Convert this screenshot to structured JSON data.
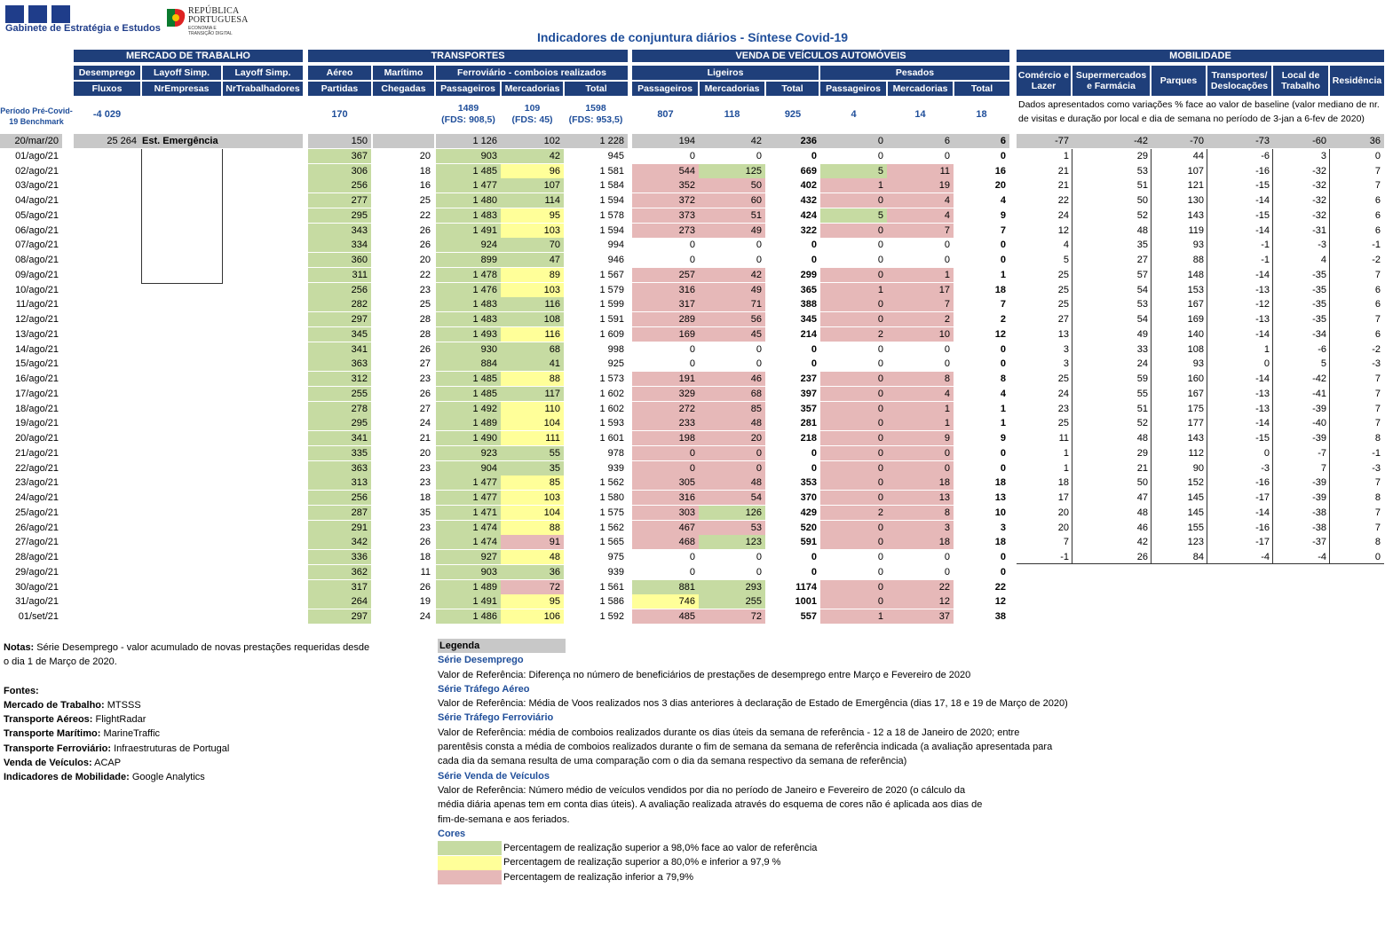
{
  "org_name": "Gabinete de Estratégia e Estudos",
  "rep_logo": {
    "line1": "REPÚBLICA",
    "line2": "PORTUGUESA",
    "line3": "ECONOMIA E TRANSIÇÃO DIGITAL"
  },
  "title": "Indicadores de conjuntura diários - Síntese Covid-19",
  "sections": {
    "mercado": "MERCADO DE TRABALHO",
    "transportes": "TRANSPORTES",
    "veiculos": "VENDA DE VEÍCULOS AUTOMÓVEIS",
    "mobilidade": "MOBILIDADE"
  },
  "headers": {
    "desemprego": "Desemprego",
    "fluxos": "Fluxos",
    "layoff1": "Layoff Simp.",
    "nrempresas": "NrEmpresas",
    "layoff2": "Layoff Simp.",
    "nrtrab": "NrTrabalhadores",
    "aereo": "Aéreo",
    "partidas": "Partidas",
    "maritimo": "Marítimo",
    "chegadas": "Chegadas",
    "ferroviario": "Ferroviário - comboios realizados",
    "passageiros": "Passageiros",
    "mercadorias": "Mercadorias",
    "total": "Total",
    "ligeiros": "Ligeiros",
    "pesados": "Pesados",
    "comercio": "Comércio e Lazer",
    "supermercados": "Supermercados e Farmácia",
    "parques": "Parques",
    "transportes_desl": "Transportes/ Deslocações",
    "local_trabalho": "Local de Trabalho",
    "residencia": "Residência"
  },
  "benchmark": {
    "label": "Período Pré-Covid-19 Benchmark",
    "desemprego": "-4 029",
    "aereo": "170",
    "ferro_pass": "1489",
    "ferro_pass_fds": "(FDS: 908,5)",
    "ferro_merc": "109",
    "ferro_merc_fds": "(FDS: 45)",
    "ferro_total": "1598",
    "ferro_total_fds": "(FDS: 953,5)",
    "lig_pass": "807",
    "lig_merc": "118",
    "lig_total": "925",
    "pes_pass": "4",
    "pes_merc": "14",
    "pes_total": "18",
    "mobility_note": "Dados apresentados como variações % face ao valor de baseline (valor mediano de nr. de visitas e duração por local e dia de semana no período de 3-jan a 6-fev de 2020)"
  },
  "ref_row": {
    "date": "20/mar/20",
    "desemprego": "25 264",
    "label": "Est. Emergência",
    "aereo": "150",
    "ferro_pass": "1 126",
    "ferro_merc": "102",
    "ferro_total": "1 228",
    "lig_pass": "194",
    "lig_merc": "42",
    "lig_total": "236",
    "pes_pass": "0",
    "pes_merc": "6",
    "pes_total": "6",
    "mob": [
      "-77",
      "-42",
      "-70",
      "-73",
      "-60",
      "36"
    ]
  },
  "colors": {
    "green": "#c6dba2",
    "yellow": "#ffff99",
    "red": "#e6b8b8",
    "header": "#1f3f7a",
    "title": "#1f4e9a"
  },
  "rows": [
    {
      "date": "01/ago/21",
      "aer": "367",
      "mar": "20",
      "fp": "903",
      "fm": "42",
      "ft": "945",
      "lp": "0",
      "lm": "0",
      "lt": "0",
      "pp": "0",
      "pm": "0",
      "pt": "0",
      "mob": [
        "1",
        "29",
        "44",
        "-6",
        "3",
        "0"
      ],
      "c": {
        "fm": "g"
      }
    },
    {
      "date": "02/ago/21",
      "aer": "306",
      "mar": "18",
      "fp": "1 485",
      "fm": "96",
      "ft": "1 581",
      "lp": "544",
      "lm": "125",
      "lt": "669",
      "pp": "5",
      "pm": "11",
      "pt": "16",
      "mob": [
        "21",
        "53",
        "107",
        "-16",
        "-32",
        "7"
      ],
      "c": {
        "fm": "y",
        "lp": "r",
        "lm": "g",
        "pp": "g",
        "pm": "r"
      }
    },
    {
      "date": "03/ago/21",
      "aer": "256",
      "mar": "16",
      "fp": "1 477",
      "fm": "107",
      "ft": "1 584",
      "lp": "352",
      "lm": "50",
      "lt": "402",
      "pp": "1",
      "pm": "19",
      "pt": "20",
      "mob": [
        "21",
        "51",
        "121",
        "-15",
        "-32",
        "7"
      ],
      "c": {
        "fm": "g",
        "lp": "r",
        "lm": "r",
        "pp": "r",
        "pm": "r"
      }
    },
    {
      "date": "04/ago/21",
      "aer": "277",
      "mar": "25",
      "fp": "1 480",
      "fm": "114",
      "ft": "1 594",
      "lp": "372",
      "lm": "60",
      "lt": "432",
      "pp": "0",
      "pm": "4",
      "pt": "4",
      "mob": [
        "22",
        "50",
        "130",
        "-14",
        "-32",
        "6"
      ],
      "c": {
        "fm": "g",
        "lp": "r",
        "lm": "r",
        "pp": "r",
        "pm": "r"
      }
    },
    {
      "date": "05/ago/21",
      "aer": "295",
      "mar": "22",
      "fp": "1 483",
      "fm": "95",
      "ft": "1 578",
      "lp": "373",
      "lm": "51",
      "lt": "424",
      "pp": "5",
      "pm": "4",
      "pt": "9",
      "mob": [
        "24",
        "52",
        "143",
        "-15",
        "-32",
        "6"
      ],
      "c": {
        "fm": "y",
        "lp": "r",
        "lm": "r",
        "pp": "g",
        "pm": "r"
      }
    },
    {
      "date": "06/ago/21",
      "aer": "343",
      "mar": "26",
      "fp": "1 491",
      "fm": "103",
      "ft": "1 594",
      "lp": "273",
      "lm": "49",
      "lt": "322",
      "pp": "0",
      "pm": "7",
      "pt": "7",
      "mob": [
        "12",
        "48",
        "119",
        "-14",
        "-31",
        "6"
      ],
      "c": {
        "fm": "y",
        "lp": "r",
        "lm": "r",
        "pp": "r",
        "pm": "r"
      }
    },
    {
      "date": "07/ago/21",
      "aer": "334",
      "mar": "26",
      "fp": "924",
      "fm": "70",
      "ft": "994",
      "lp": "0",
      "lm": "0",
      "lt": "0",
      "pp": "0",
      "pm": "0",
      "pt": "0",
      "mob": [
        "4",
        "35",
        "93",
        "-1",
        "-3",
        "-1"
      ],
      "c": {
        "fm": "g"
      }
    },
    {
      "date": "08/ago/21",
      "aer": "360",
      "mar": "20",
      "fp": "899",
      "fm": "47",
      "ft": "946",
      "lp": "0",
      "lm": "0",
      "lt": "0",
      "pp": "0",
      "pm": "0",
      "pt": "0",
      "mob": [
        "5",
        "27",
        "88",
        "-1",
        "4",
        "-2"
      ],
      "c": {
        "fm": "g"
      }
    },
    {
      "date": "09/ago/21",
      "aer": "311",
      "mar": "22",
      "fp": "1 478",
      "fm": "89",
      "ft": "1 567",
      "lp": "257",
      "lm": "42",
      "lt": "299",
      "pp": "0",
      "pm": "1",
      "pt": "1",
      "mob": [
        "25",
        "57",
        "148",
        "-14",
        "-35",
        "7"
      ],
      "c": {
        "fm": "y",
        "lp": "r",
        "lm": "r",
        "pp": "r",
        "pm": "r"
      }
    },
    {
      "date": "10/ago/21",
      "aer": "256",
      "mar": "23",
      "fp": "1 476",
      "fm": "103",
      "ft": "1 579",
      "lp": "316",
      "lm": "49",
      "lt": "365",
      "pp": "1",
      "pm": "17",
      "pt": "18",
      "mob": [
        "25",
        "54",
        "153",
        "-13",
        "-35",
        "6"
      ],
      "c": {
        "fm": "y",
        "lp": "r",
        "lm": "r",
        "pp": "r",
        "pm": "r"
      }
    },
    {
      "date": "11/ago/21",
      "aer": "282",
      "mar": "25",
      "fp": "1 483",
      "fm": "116",
      "ft": "1 599",
      "lp": "317",
      "lm": "71",
      "lt": "388",
      "pp": "0",
      "pm": "7",
      "pt": "7",
      "mob": [
        "25",
        "53",
        "167",
        "-12",
        "-35",
        "6"
      ],
      "c": {
        "fm": "g",
        "lp": "r",
        "lm": "r",
        "pp": "r",
        "pm": "r"
      }
    },
    {
      "date": "12/ago/21",
      "aer": "297",
      "mar": "28",
      "fp": "1 483",
      "fm": "108",
      "ft": "1 591",
      "lp": "289",
      "lm": "56",
      "lt": "345",
      "pp": "0",
      "pm": "2",
      "pt": "2",
      "mob": [
        "27",
        "54",
        "169",
        "-13",
        "-35",
        "7"
      ],
      "c": {
        "fm": "g",
        "lp": "r",
        "lm": "r",
        "pp": "r",
        "pm": "r"
      }
    },
    {
      "date": "13/ago/21",
      "aer": "345",
      "mar": "28",
      "fp": "1 493",
      "fm": "116",
      "ft": "1 609",
      "lp": "169",
      "lm": "45",
      "lt": "214",
      "pp": "2",
      "pm": "10",
      "pt": "12",
      "mob": [
        "13",
        "49",
        "140",
        "-14",
        "-34",
        "6"
      ],
      "c": {
        "fm": "y",
        "lp": "r",
        "lm": "r",
        "pp": "r",
        "pm": "r"
      }
    },
    {
      "date": "14/ago/21",
      "aer": "341",
      "mar": "26",
      "fp": "930",
      "fm": "68",
      "ft": "998",
      "lp": "0",
      "lm": "0",
      "lt": "0",
      "pp": "0",
      "pm": "0",
      "pt": "0",
      "mob": [
        "3",
        "33",
        "108",
        "1",
        "-6",
        "-2"
      ],
      "c": {
        "fm": "g"
      }
    },
    {
      "date": "15/ago/21",
      "aer": "363",
      "mar": "27",
      "fp": "884",
      "fm": "41",
      "ft": "925",
      "lp": "0",
      "lm": "0",
      "lt": "0",
      "pp": "0",
      "pm": "0",
      "pt": "0",
      "mob": [
        "3",
        "24",
        "93",
        "0",
        "5",
        "-3"
      ],
      "c": {
        "fm": "g"
      }
    },
    {
      "date": "16/ago/21",
      "aer": "312",
      "mar": "23",
      "fp": "1 485",
      "fm": "88",
      "ft": "1 573",
      "lp": "191",
      "lm": "46",
      "lt": "237",
      "pp": "0",
      "pm": "8",
      "pt": "8",
      "mob": [
        "25",
        "59",
        "160",
        "-14",
        "-42",
        "7"
      ],
      "c": {
        "fm": "y",
        "lp": "r",
        "lm": "r",
        "pp": "r",
        "pm": "r"
      }
    },
    {
      "date": "17/ago/21",
      "aer": "255",
      "mar": "26",
      "fp": "1 485",
      "fm": "117",
      "ft": "1 602",
      "lp": "329",
      "lm": "68",
      "lt": "397",
      "pp": "0",
      "pm": "4",
      "pt": "4",
      "mob": [
        "24",
        "55",
        "167",
        "-13",
        "-41",
        "7"
      ],
      "c": {
        "fm": "g",
        "lp": "r",
        "lm": "r",
        "pp": "r",
        "pm": "r"
      }
    },
    {
      "date": "18/ago/21",
      "aer": "278",
      "mar": "27",
      "fp": "1 492",
      "fm": "110",
      "ft": "1 602",
      "lp": "272",
      "lm": "85",
      "lt": "357",
      "pp": "0",
      "pm": "1",
      "pt": "1",
      "mob": [
        "23",
        "51",
        "175",
        "-13",
        "-39",
        "7"
      ],
      "c": {
        "fm": "y",
        "lp": "r",
        "lm": "r",
        "pp": "r",
        "pm": "r"
      }
    },
    {
      "date": "19/ago/21",
      "aer": "295",
      "mar": "24",
      "fp": "1 489",
      "fm": "104",
      "ft": "1 593",
      "lp": "233",
      "lm": "48",
      "lt": "281",
      "pp": "0",
      "pm": "1",
      "pt": "1",
      "mob": [
        "25",
        "52",
        "177",
        "-14",
        "-40",
        "7"
      ],
      "c": {
        "fm": "y",
        "lp": "r",
        "lm": "r",
        "pp": "r",
        "pm": "r"
      }
    },
    {
      "date": "20/ago/21",
      "aer": "341",
      "mar": "21",
      "fp": "1 490",
      "fm": "111",
      "ft": "1 601",
      "lp": "198",
      "lm": "20",
      "lt": "218",
      "pp": "0",
      "pm": "9",
      "pt": "9",
      "mob": [
        "11",
        "48",
        "143",
        "-15",
        "-39",
        "8"
      ],
      "c": {
        "fm": "y",
        "lp": "r",
        "lm": "r",
        "pp": "r",
        "pm": "r"
      }
    },
    {
      "date": "21/ago/21",
      "aer": "335",
      "mar": "20",
      "fp": "923",
      "fm": "55",
      "ft": "978",
      "lp": "0",
      "lm": "0",
      "lt": "0",
      "pp": "0",
      "pm": "0",
      "pt": "0",
      "mob": [
        "1",
        "29",
        "112",
        "0",
        "-7",
        "-1"
      ],
      "c": {
        "fm": "g",
        "lp": "r",
        "lm": "r",
        "pp": "r",
        "pm": "r"
      }
    },
    {
      "date": "22/ago/21",
      "aer": "363",
      "mar": "23",
      "fp": "904",
      "fm": "35",
      "ft": "939",
      "lp": "0",
      "lm": "0",
      "lt": "0",
      "pp": "0",
      "pm": "0",
      "pt": "0",
      "mob": [
        "1",
        "21",
        "90",
        "-3",
        "7",
        "-3"
      ],
      "c": {
        "fm": "g",
        "lp": "r",
        "lm": "r",
        "pp": "r",
        "pm": "r"
      }
    },
    {
      "date": "23/ago/21",
      "aer": "313",
      "mar": "23",
      "fp": "1 477",
      "fm": "85",
      "ft": "1 562",
      "lp": "305",
      "lm": "48",
      "lt": "353",
      "pp": "0",
      "pm": "18",
      "pt": "18",
      "mob": [
        "18",
        "50",
        "152",
        "-16",
        "-39",
        "7"
      ],
      "c": {
        "fm": "y",
        "lp": "r",
        "lm": "r",
        "pp": "r",
        "pm": "r"
      }
    },
    {
      "date": "24/ago/21",
      "aer": "256",
      "mar": "18",
      "fp": "1 477",
      "fm": "103",
      "ft": "1 580",
      "lp": "316",
      "lm": "54",
      "lt": "370",
      "pp": "0",
      "pm": "13",
      "pt": "13",
      "mob": [
        "17",
        "47",
        "145",
        "-17",
        "-39",
        "8"
      ],
      "c": {
        "fm": "y",
        "lp": "r",
        "lm": "r",
        "pp": "r",
        "pm": "r"
      }
    },
    {
      "date": "25/ago/21",
      "aer": "287",
      "mar": "35",
      "fp": "1 471",
      "fm": "104",
      "ft": "1 575",
      "lp": "303",
      "lm": "126",
      "lt": "429",
      "pp": "2",
      "pm": "8",
      "pt": "10",
      "mob": [
        "20",
        "48",
        "145",
        "-14",
        "-38",
        "7"
      ],
      "c": {
        "fm": "y",
        "lp": "r",
        "lm": "g",
        "pp": "r",
        "pm": "r"
      }
    },
    {
      "date": "26/ago/21",
      "aer": "291",
      "mar": "23",
      "fp": "1 474",
      "fm": "88",
      "ft": "1 562",
      "lp": "467",
      "lm": "53",
      "lt": "520",
      "pp": "0",
      "pm": "3",
      "pt": "3",
      "mob": [
        "20",
        "46",
        "155",
        "-16",
        "-38",
        "7"
      ],
      "c": {
        "fm": "y",
        "lp": "r",
        "lm": "r",
        "pp": "r",
        "pm": "r"
      }
    },
    {
      "date": "27/ago/21",
      "aer": "342",
      "mar": "26",
      "fp": "1 474",
      "fm": "91",
      "ft": "1 565",
      "lp": "468",
      "lm": "123",
      "lt": "591",
      "pp": "0",
      "pm": "18",
      "pt": "18",
      "mob": [
        "7",
        "42",
        "123",
        "-17",
        "-37",
        "8"
      ],
      "c": {
        "fm": "r",
        "lp": "r",
        "lm": "g",
        "pp": "r",
        "pm": "r"
      }
    },
    {
      "date": "28/ago/21",
      "aer": "336",
      "mar": "18",
      "fp": "927",
      "fm": "48",
      "ft": "975",
      "lp": "0",
      "lm": "0",
      "lt": "0",
      "pp": "0",
      "pm": "0",
      "pt": "0",
      "mob": [
        "-1",
        "26",
        "84",
        "-4",
        "-4",
        "0"
      ],
      "c": {
        "fm": "y"
      }
    },
    {
      "date": "29/ago/21",
      "aer": "362",
      "mar": "11",
      "fp": "903",
      "fm": "36",
      "ft": "939",
      "lp": "0",
      "lm": "0",
      "lt": "0",
      "pp": "0",
      "pm": "0",
      "pt": "0",
      "mob": null,
      "c": {
        "fm": "g"
      }
    },
    {
      "date": "30/ago/21",
      "aer": "317",
      "mar": "26",
      "fp": "1 489",
      "fm": "72",
      "ft": "1 561",
      "lp": "881",
      "lm": "293",
      "lt": "1174",
      "pp": "0",
      "pm": "22",
      "pt": "22",
      "mob": null,
      "c": {
        "fm": "r",
        "lp": "g",
        "lm": "g",
        "pp": "r",
        "pm": "r"
      }
    },
    {
      "date": "31/ago/21",
      "aer": "264",
      "mar": "19",
      "fp": "1 491",
      "fm": "95",
      "ft": "1 586",
      "lp": "746",
      "lm": "255",
      "lt": "1001",
      "pp": "0",
      "pm": "12",
      "pt": "12",
      "mob": null,
      "c": {
        "fm": "y",
        "lp": "y",
        "lm": "g",
        "pp": "r",
        "pm": "r"
      }
    },
    {
      "date": "01/set/21",
      "aer": "297",
      "mar": "24",
      "fp": "1 486",
      "fm": "106",
      "ft": "1 592",
      "lp": "485",
      "lm": "72",
      "lt": "557",
      "pp": "1",
      "pm": "37",
      "pt": "38",
      "mob": null,
      "c": {
        "fm": "y",
        "lp": "r",
        "lm": "r",
        "pp": "r",
        "pm": "r"
      }
    }
  ],
  "notes": {
    "label": "Notas:",
    "text": " Série Desemprego - valor acumulado de novas prestações requeridas desde o dia 1 de Março de 2020.",
    "fontes": "Fontes:",
    "sources": [
      {
        "k": "Mercado de Trabalho:",
        "v": " MTSSS"
      },
      {
        "k": "Transporte Aéreos:",
        "v": " FlightRadar"
      },
      {
        "k": "Transporte Marítimo:",
        "v": " MarineTraffic"
      },
      {
        "k": "Transporte Ferroviário:",
        "v": " Infraestruturas de Portugal"
      },
      {
        "k": "Venda de Veículos:",
        "v": " ACAP"
      },
      {
        "k": "Indicadores de Mobilidade:",
        "v": " Google Analytics"
      }
    ]
  },
  "legend": {
    "title": "Legenda",
    "s1_title": "Série Desemprego",
    "s1_text": "Valor de Referência: Diferença no número de beneficiários de prestações de desemprego entre Março e Fevereiro de 2020",
    "s2_title": "Série Tráfego Aéreo",
    "s2_text": "Valor de Referência: Média de Voos realizados nos 3 dias anteriores à declaração de Estado de Emergência (dias 17, 18 e 19 de Março de 2020)",
    "s3_title": "Série Tráfego Ferroviário",
    "s3_text": "Valor de Referência: média de comboios realizados durante os dias úteis da semana de referência - 12 a 18 de Janeiro de 2020; entre parentêsis consta a média de comboios realizados durante o fim de semana da semana de referência indicada (a avaliação apresentada para cada dia da semana resulta de uma comparação com o dia da semana respectivo da semana de referência)",
    "s4_title": "Série Venda de Veículos",
    "s4_text": "Valor de Referência: Número médio de veículos vendidos por dia no período de Janeiro e Fevereiro de 2020 (o cálculo da média diária apenas tem em conta dias úteis). A avaliação realizada através do esquema de cores não é aplicada aos dias de fim-de-semana e aos feriados.",
    "cores": "Cores",
    "c1": "Percentagem de realização superior a 98,0% face ao valor de referência",
    "c2": "Percentagem de realização superior a 80,0% e inferior a 97,9 %",
    "c3": "Percentagem de realização inferior a 79,9%"
  }
}
